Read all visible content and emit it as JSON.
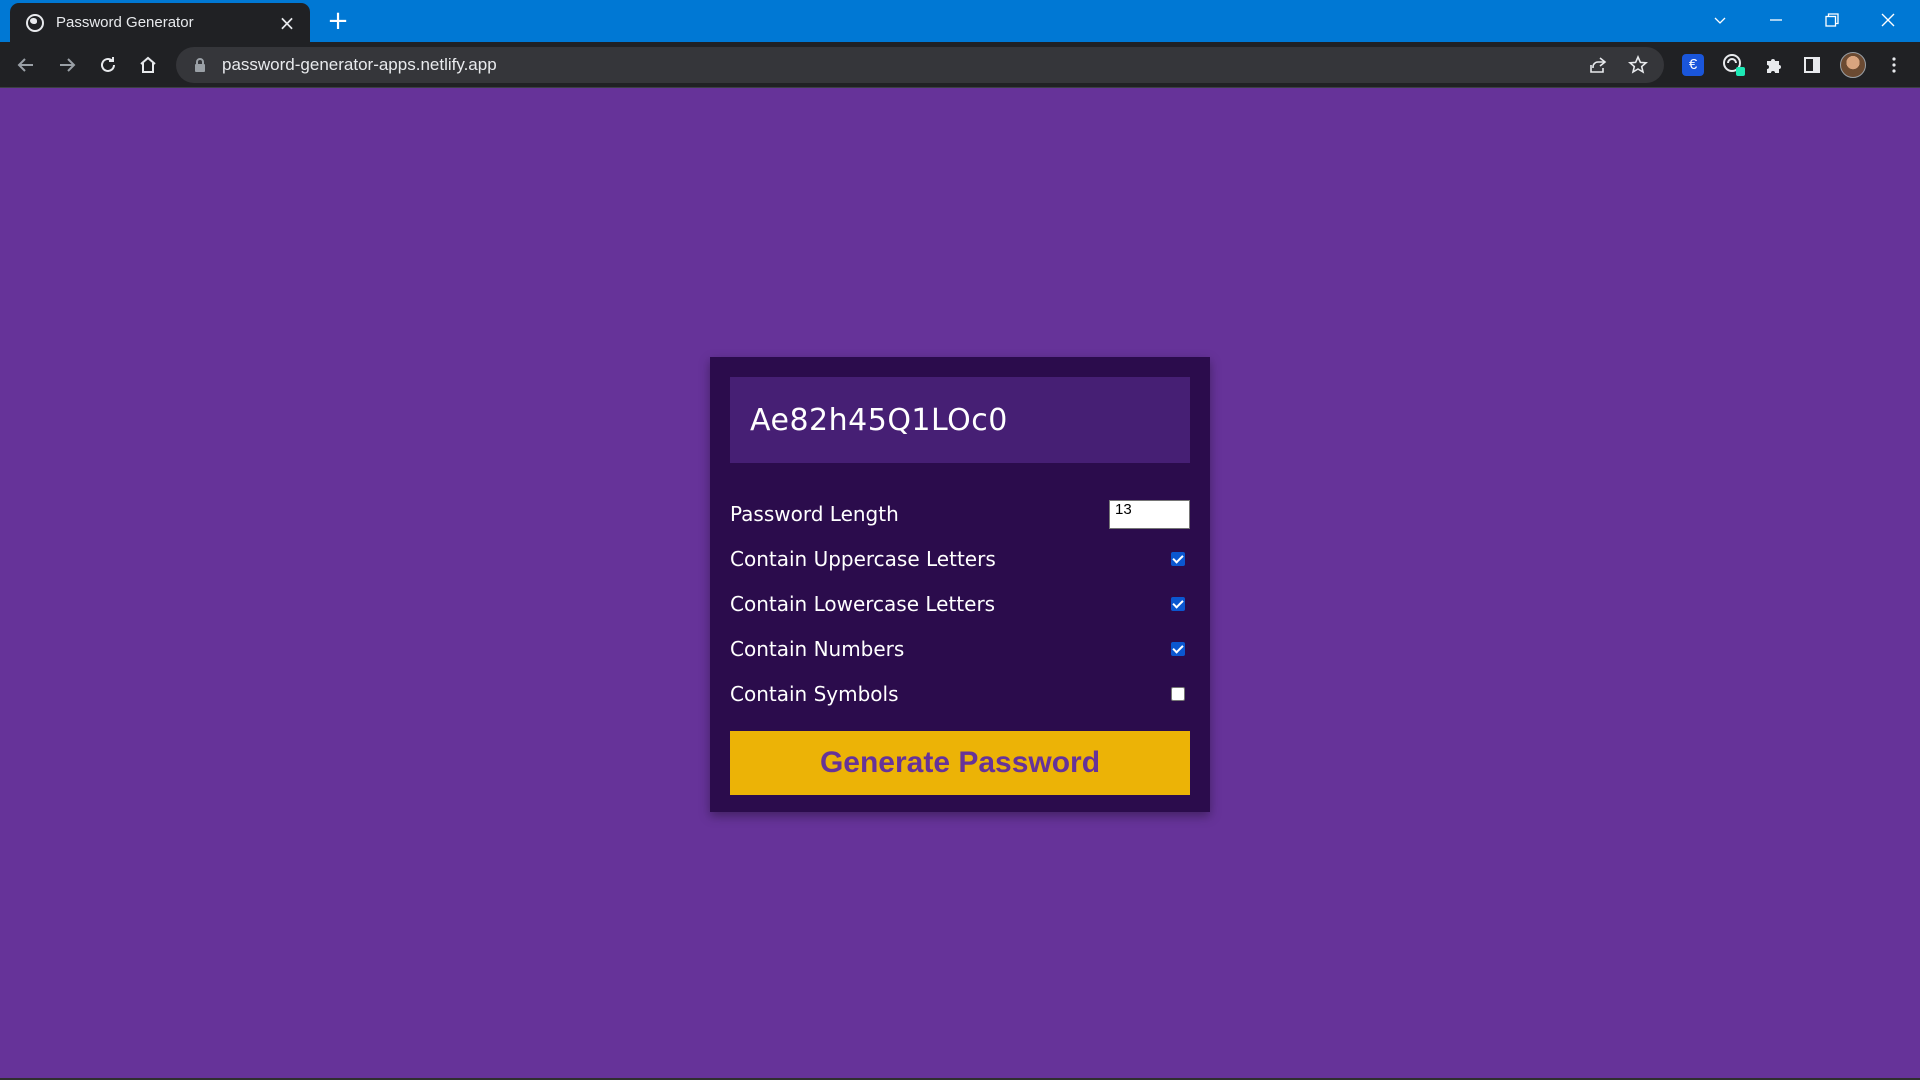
{
  "browser": {
    "tab_title": "Password Generator",
    "url": "password-generator-apps.netlify.app",
    "icons": {
      "tab_favicon": "globe-icon",
      "tab_close": "close-icon",
      "new_tab": "plus-icon",
      "back": "arrow-left-icon",
      "forward": "arrow-right-icon",
      "reload": "reload-icon",
      "home": "home-icon",
      "lock": "lock-icon",
      "share": "share-icon",
      "bookmark": "star-icon",
      "extension_euro": "euro-icon",
      "extension_colorpicker": "color-picker-icon",
      "extensions": "puzzle-icon",
      "side_panel": "side-panel-icon",
      "menu": "kebab-menu-icon"
    },
    "extension_euro_glyph": "€"
  },
  "app": {
    "password": "Ae82h45Q1LOc0",
    "settings": {
      "length_label": "Password Length",
      "length_value": "13",
      "uppercase_label": "Contain Uppercase Letters",
      "uppercase_checked": true,
      "lowercase_label": "Contain Lowercase Letters",
      "lowercase_checked": true,
      "numbers_label": "Contain Numbers",
      "numbers_checked": true,
      "symbols_label": "Contain Symbols",
      "symbols_checked": false
    },
    "generate_button": "Generate Password"
  },
  "colors": {
    "page_background": "#663399",
    "card_background": "#2b0c4c",
    "result_background": "#461f74",
    "button_background": "#ecb306",
    "button_text": "#663399",
    "checkbox_checked": "#0b57d0",
    "titlebar": "#0078d4"
  }
}
